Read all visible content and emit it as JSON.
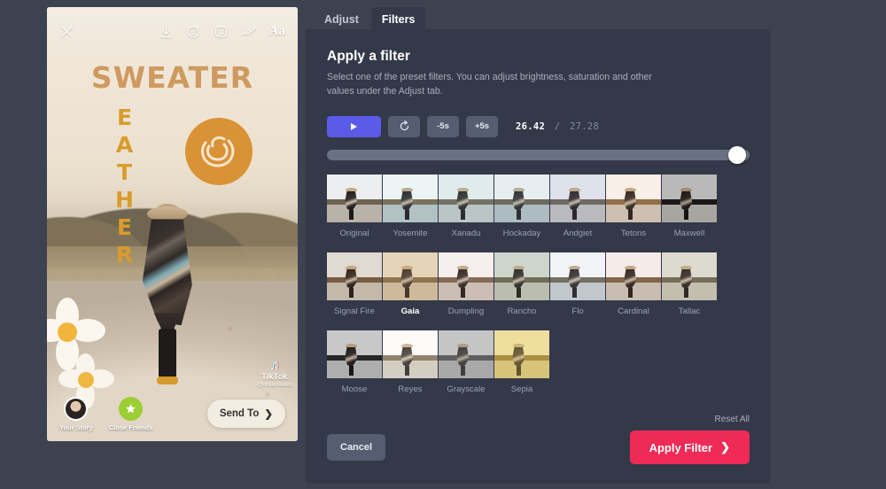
{
  "preview": {
    "toolbar": [
      {
        "name": "close-icon",
        "label": "Close"
      },
      {
        "name": "download-icon",
        "label": "Download"
      },
      {
        "name": "effects-face-icon",
        "label": "Effects"
      },
      {
        "name": "sticker-icon",
        "label": "Stickers"
      },
      {
        "name": "draw-icon",
        "label": "Draw"
      },
      {
        "name": "text-icon",
        "label": "Aa"
      }
    ],
    "overlay": {
      "headline": "SWEATER",
      "vertical_word": "EATHER",
      "badge_icon": "sweater-badge-icon"
    },
    "watermark": {
      "note_icon": "tiktok-note-icon",
      "brand": "TikTok",
      "username": "@nolacreates"
    },
    "bottom": {
      "your_story_label": "Your Story",
      "close_friends_label": "Close Friends",
      "send_to_label": "Send To",
      "send_to_chevron": "❯"
    }
  },
  "editor": {
    "tabs": [
      {
        "label": "Adjust",
        "active": false
      },
      {
        "label": "Filters",
        "active": true
      }
    ],
    "panel": {
      "title": "Apply a filter",
      "description": "Select one of the preset filters. You can adjust brightness, saturation and other values under the Adjust tab."
    },
    "transport": {
      "play_label": "Play",
      "restart_label": "Restart",
      "back_label": "-5s",
      "forward_label": "+5s",
      "current_time": "26.42",
      "separator": "/",
      "total_time": "27.28",
      "progress_percent": 97
    },
    "filters": {
      "selected": "Gaia",
      "rows": [
        [
          {
            "label": "Original",
            "thumb": {
              "sky": "#eceef0",
              "hill": "#6d6250",
              "ground": "#b9b2a8",
              "tint": "rgba(255,255,255,0)"
            }
          },
          {
            "label": "Yosemite",
            "thumb": {
              "sky": "#fdfdfd",
              "hill": "#7a6a4e",
              "ground": "#b9c3c4",
              "tint": "rgba(120,180,200,0.12)"
            }
          },
          {
            "label": "Xanadu",
            "thumb": {
              "sky": "#eef3f4",
              "hill": "#6f6755",
              "ground": "#c2c6c4",
              "tint": "rgba(140,190,195,0.14)"
            }
          },
          {
            "label": "Hockaday",
            "thumb": {
              "sky": "#fbfbfb",
              "hill": "#6b5f4c",
              "ground": "#b4bfc2",
              "tint": "rgba(130,175,195,0.16)"
            }
          },
          {
            "label": "Andgiet",
            "thumb": {
              "sky": "#e9ecf1",
              "hill": "#6a6458",
              "ground": "#c0bfbd",
              "tint": "rgba(150,160,190,0.12)"
            }
          },
          {
            "label": "Tetons",
            "thumb": {
              "sky": "#fcfcfc",
              "hill": "#8a6b45",
              "ground": "#cdc6bc",
              "tint": "rgba(210,150,90,0.12)"
            }
          },
          {
            "label": "Maxwell",
            "thumb": {
              "sky": "#e2e2e2",
              "hill": "#201e1c",
              "ground": "#cfcbc5",
              "tint": "rgba(0,0,0,0.18)"
            }
          }
        ],
        [
          {
            "label": "Signal Fire",
            "thumb": {
              "sky": "#e6e6e2",
              "hill": "#6f5b43",
              "ground": "#c6c0b7",
              "tint": "rgba(190,120,70,0.10)"
            }
          },
          {
            "label": "Gaia",
            "thumb": {
              "sky": "#ebdfcb",
              "hill": "#7d6344",
              "ground": "#cdbda6",
              "tint": "rgba(215,175,120,0.22)"
            }
          },
          {
            "label": "Dumpling",
            "thumb": {
              "sky": "#fbfafa",
              "hill": "#7b6350",
              "ground": "#cbc2b9",
              "tint": "rgba(215,165,150,0.12)"
            }
          },
          {
            "label": "Rancho",
            "thumb": {
              "sky": "#d8ded7",
              "hill": "#6a6450",
              "ground": "#c3c1b5",
              "tint": "rgba(140,170,140,0.14)"
            }
          },
          {
            "label": "Flo",
            "thumb": {
              "sky": "#fdfdfd",
              "hill": "#6d6252",
              "ground": "#c5c9cc",
              "tint": "rgba(170,190,215,0.14)"
            }
          },
          {
            "label": "Cardinal",
            "thumb": {
              "sky": "#fcfbfb",
              "hill": "#7a6147",
              "ground": "#cac4ba",
              "tint": "rgba(200,130,110,0.12)"
            }
          },
          {
            "label": "Tallac",
            "thumb": {
              "sky": "#e3e1da",
              "hill": "#6f6552",
              "ground": "#c6c1b4",
              "tint": "rgba(180,175,140,0.12)"
            }
          }
        ],
        [
          {
            "label": "Moose",
            "thumb": {
              "sky": "#d9d9d9",
              "hill": "#2a2a2a",
              "ground": "#bdbdbd",
              "tint": "rgba(0,0,0,0.08)"
            }
          },
          {
            "label": "Reyes",
            "thumb": {
              "sky": "#fdfdfd",
              "hill": "#7b6a55",
              "ground": "#cbc5bb",
              "tint": "rgba(255,245,230,0.18)"
            }
          },
          {
            "label": "Grayscale",
            "thumb": {
              "sky": "#eaeaea",
              "hill": "#4d4d4d",
              "ground": "#bdbdbd",
              "tint": "rgba(128,128,128,0.35)"
            }
          },
          {
            "label": "Sepia",
            "thumb": {
              "sky": "#f5eec2",
              "hill": "#8a7432",
              "ground": "#d3c48a",
              "tint": "rgba(225,195,95,0.35)"
            }
          }
        ]
      ]
    },
    "reset_all_label": "Reset All",
    "footer": {
      "cancel_label": "Cancel",
      "apply_label": "Apply Filter",
      "apply_chevron": "❯"
    },
    "colors": {
      "accent_play": "#5a5ce8",
      "accent_apply": "#ef2a56",
      "panel_bg": "#343949",
      "app_bg": "#3d4251"
    }
  }
}
